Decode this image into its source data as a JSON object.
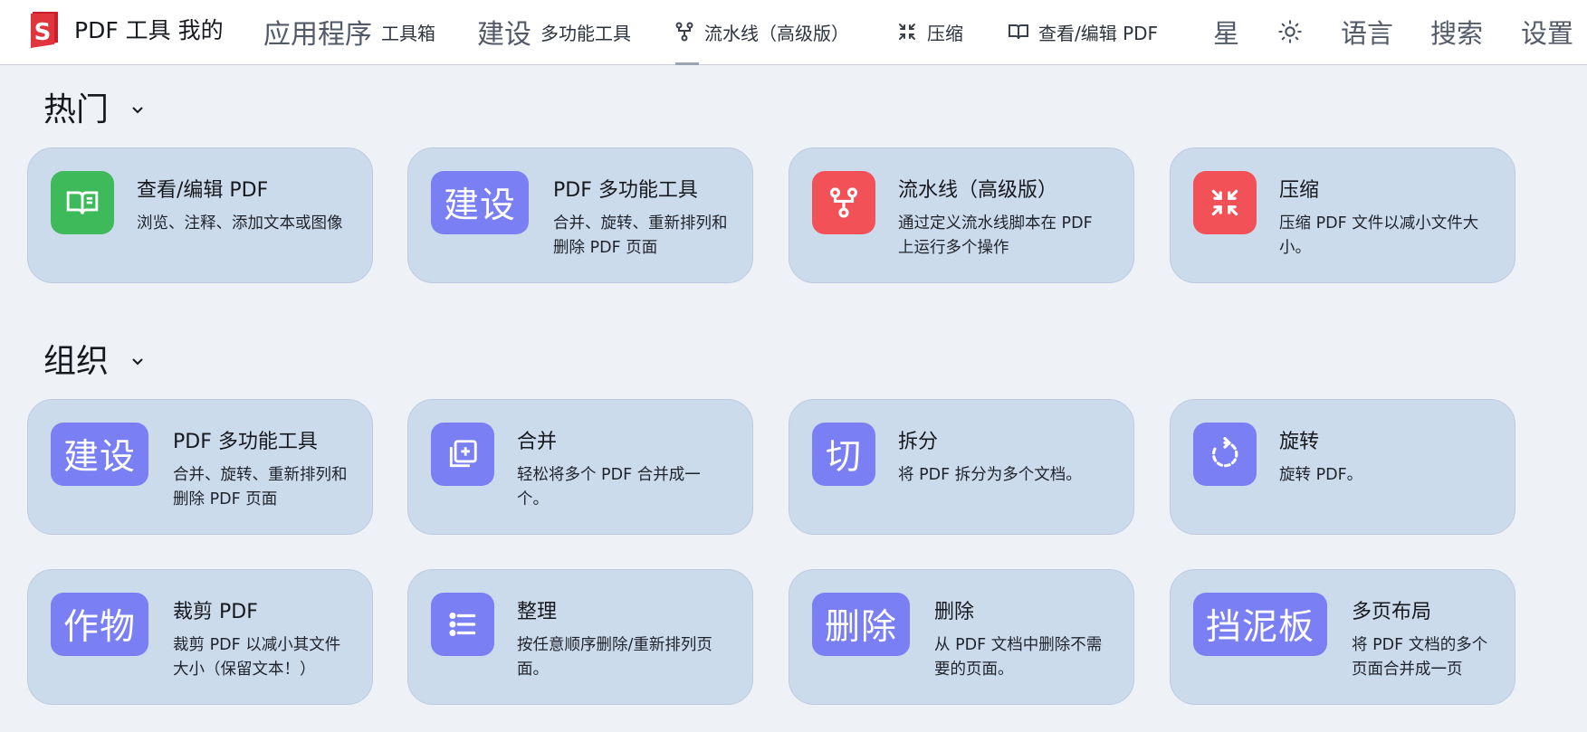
{
  "header": {
    "brand": "PDF 工具 我的",
    "nav": [
      {
        "big": "应用程序",
        "small": "工具箱"
      },
      {
        "big": "建设",
        "small": "多功能工具"
      }
    ],
    "pipeline_label": "流水线（高级版）",
    "compress_label": "压缩",
    "view_edit_label": "查看/编辑 PDF",
    "star_label": "星",
    "language_label": "语言",
    "search_label": "搜索",
    "settings_label": "设置"
  },
  "sections": {
    "popular": {
      "title": "热门",
      "cards": [
        {
          "title": "查看/编辑 PDF",
          "desc": "浏览、注释、添加文本或图像",
          "icon": "book-open-icon",
          "color": "#3fba5a"
        },
        {
          "title": "PDF 多功能工具",
          "desc": "合并、旋转、重新排列和删除 PDF 页面",
          "tile_text": "建设",
          "color": "#7a80f4"
        },
        {
          "title": "流水线（高级版）",
          "desc": "通过定义流水线脚本在 PDF 上运行多个操作",
          "icon": "pipeline-icon",
          "color": "#f25157"
        },
        {
          "title": "压缩",
          "desc": "压缩 PDF 文件以减小文件大小。",
          "icon": "compress-icon",
          "color": "#f25157"
        }
      ]
    },
    "organize": {
      "title": "组织",
      "cards": [
        {
          "title": "PDF 多功能工具",
          "desc": "合并、旋转、重新排列和删除 PDF 页面",
          "tile_text": "建设",
          "color": "#7a80f4"
        },
        {
          "title": "合并",
          "desc": "轻松将多个 PDF 合并成一个。",
          "icon": "merge-icon",
          "color": "#7a80f4"
        },
        {
          "title": "拆分",
          "desc": "将 PDF 拆分为多个文档。",
          "tile_text": "切",
          "color": "#7a80f4"
        },
        {
          "title": "旋转",
          "desc": "旋转 PDF。",
          "icon": "rotate-icon",
          "color": "#7a80f4"
        },
        {
          "title": "裁剪 PDF",
          "desc": "裁剪 PDF 以减小其文件大小（保留文本！）",
          "tile_text": "作物",
          "color": "#7a80f4"
        },
        {
          "title": "整理",
          "desc": "按任意顺序删除/重新排列页面。",
          "icon": "list-icon",
          "color": "#7a80f4"
        },
        {
          "title": "删除",
          "desc": "从 PDF 文档中删除不需要的页面。",
          "tile_text": "删除",
          "color": "#7a80f4"
        },
        {
          "title": "多页布局",
          "desc": "将 PDF 文档的多个页面合并成一页",
          "tile_text": "挡泥板",
          "color": "#7a80f4"
        }
      ]
    }
  },
  "colors": {
    "accent": "#7a80f4",
    "green": "#3fba5a",
    "red": "#f25157",
    "card_bg": "#ccdbeb",
    "page_bg": "#eef1f6"
  }
}
